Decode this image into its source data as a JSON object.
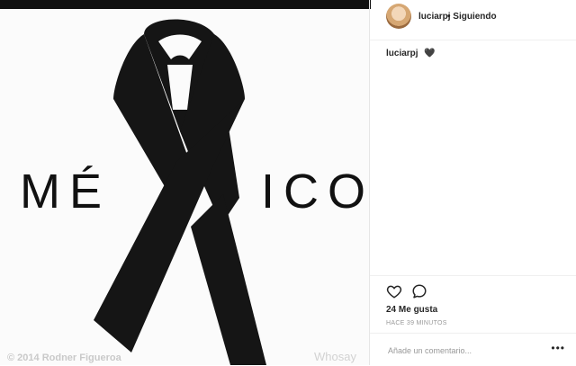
{
  "post": {
    "image_text": {
      "left": "MÉ",
      "right": "ICO"
    },
    "watermark": "© 2014 Rodner Figueroa",
    "watermark_right": "Whosay"
  },
  "header": {
    "username": "luciarpj",
    "separator_follow": "• Siguiendo"
  },
  "caption": {
    "username": "luciarpj",
    "emoji": "🖤"
  },
  "actions": {
    "like_icon": "heart-icon",
    "comment_icon": "comment-icon"
  },
  "likes": "24 Me gusta",
  "time": "HACE 39 MINUTOS",
  "comment": {
    "placeholder": "Añade un comentario...",
    "more": "•••"
  }
}
